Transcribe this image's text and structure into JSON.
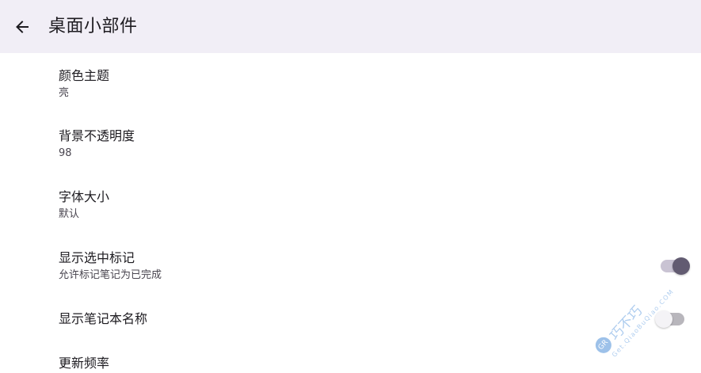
{
  "header": {
    "title": "桌面小部件",
    "back_icon": "arrow-back-icon",
    "background_color": "#f1eef6"
  },
  "settings": [
    {
      "title": "颜色主题",
      "summary": "亮"
    },
    {
      "title": "背景不透明度",
      "summary": "98"
    },
    {
      "title": "字体大小",
      "summary": "默认"
    },
    {
      "title": "显示选中标记",
      "summary": "允许标记笔记为已完成",
      "switch": "on"
    },
    {
      "title": "显示笔记本名称",
      "switch": "off"
    },
    {
      "title": "更新频率"
    }
  ],
  "watermark": {
    "logo": "GR",
    "main": "巧不巧",
    "sub": "Get.QiaoBuQiao.COM"
  },
  "colors": {
    "accent": "#625b71",
    "switch_track_on": "#c9c3d3",
    "switch_track_off": "#b8b6bc"
  }
}
